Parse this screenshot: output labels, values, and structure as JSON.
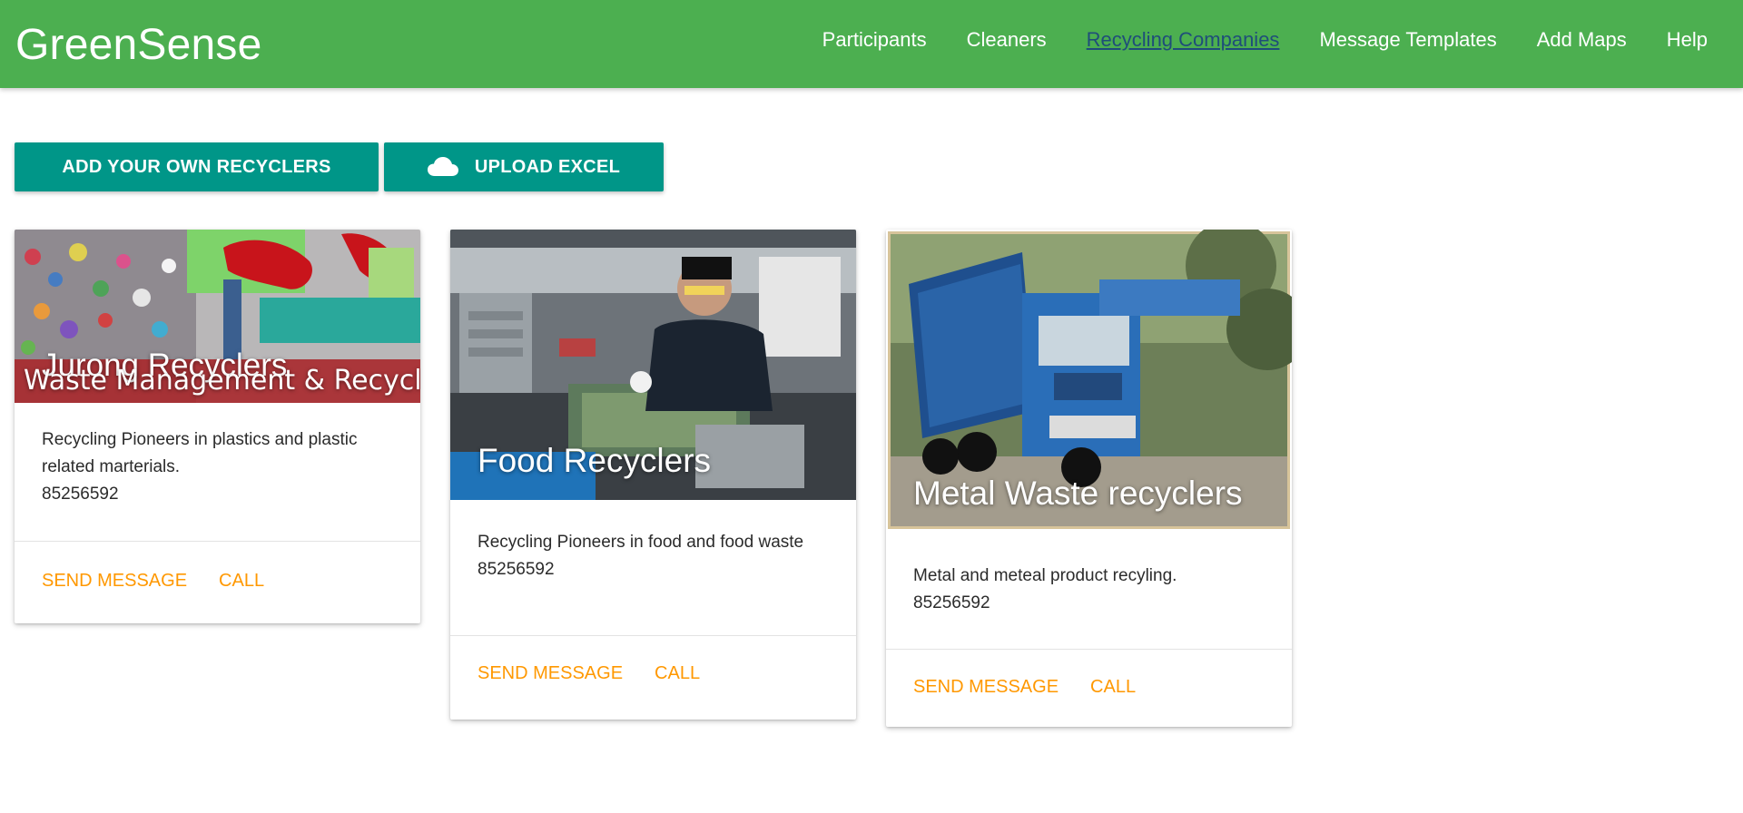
{
  "navbar": {
    "brand": "GreenSense",
    "links": [
      "Participants",
      "Cleaners",
      "Recycling Companies",
      "Message Templates",
      "Add Maps",
      "Help"
    ],
    "active": "Recycling Companies"
  },
  "toolbar": {
    "add_label": "ADD YOUR OWN RECYCLERS",
    "upload_label": "UPLOAD EXCEL",
    "upload_icon": "cloud-icon",
    "button_color": "#009688"
  },
  "colors": {
    "navbar": "#4caf50",
    "action": "#ff9800",
    "active_link": "#1f4e79"
  },
  "cards": [
    {
      "title": "Jurong Recyclers",
      "banner_text": "Waste Management & Recycling",
      "description": "Recycling Pioneers in plastics and plastic related marterials.",
      "phone": "85256592",
      "actions": [
        "SEND MESSAGE",
        "CALL"
      ]
    },
    {
      "title": "Food Recyclers",
      "description": "Recycling Pioneers in food and food waste",
      "phone": "85256592",
      "actions": [
        "SEND MESSAGE",
        "CALL"
      ]
    },
    {
      "title": "Metal Waste recyclers",
      "description": "Metal and meteal product recyling.",
      "phone": "85256592",
      "actions": [
        "SEND MESSAGE",
        "CALL"
      ]
    }
  ]
}
